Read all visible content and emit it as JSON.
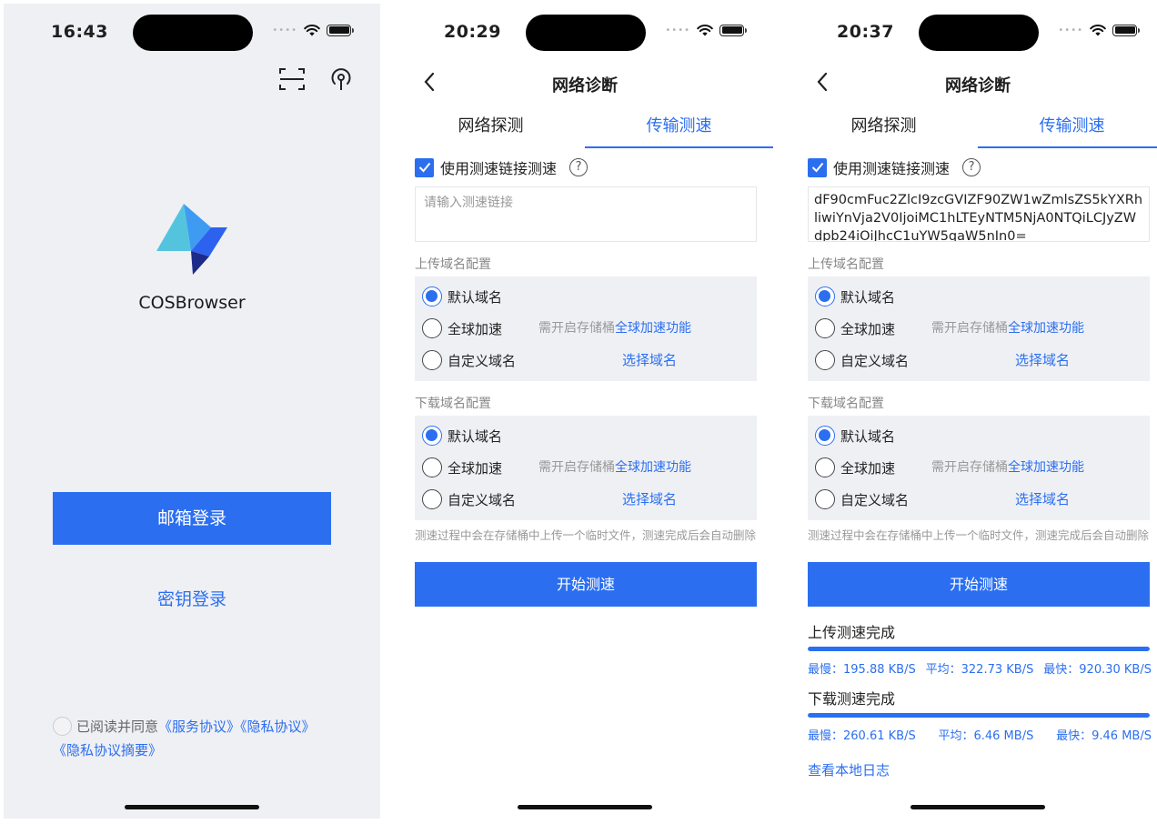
{
  "screen1": {
    "time": "16:43",
    "app_name": "COSBrowser",
    "email_login": "邮箱登录",
    "key_login": "密钥登录",
    "agree_prefix": "已阅读并同意",
    "service_link": "《服务协议》",
    "privacy_link": "《隐私协议》",
    "privacy_summary_link": "《隐私协议摘要》"
  },
  "screen2": {
    "time": "20:29",
    "title": "网络诊断",
    "tabs": [
      "网络探测",
      "传输测速"
    ],
    "checkbox_label": "使用测速链接测速",
    "link_placeholder": "请输入测速链接",
    "upload_label": "上传域名配置",
    "download_label": "下载域名配置",
    "options": {
      "default": "默认域名",
      "global": "全球加速",
      "custom": "自定义域名",
      "note_prefix": "需开启存储桶",
      "note_link": "全球加速功能",
      "choose": "选择域名"
    },
    "hint": "测速过程中会在存储桶中上传一个临时文件，测速完成后会自动删除",
    "start": "开始测速"
  },
  "screen3": {
    "time": "20:37",
    "title": "网络诊断",
    "tabs": [
      "网络探测",
      "传输测速"
    ],
    "checkbox_label": "使用测速链接测速",
    "link_value": "dF90cmFuc2ZlcI9zcGVIZF90ZW1wZmlsZS5kYXRhliwiYnVja2V0IjoiMC1hLTEyNTM5NjA0NTQiLCJyZWdpb24iOiJhcC1uYW5qaW5nIn0=",
    "upload_label": "上传域名配置",
    "download_label": "下载域名配置",
    "options": {
      "default": "默认域名",
      "global": "全球加速",
      "custom": "自定义域名",
      "note_prefix": "需开启存储桶",
      "note_link": "全球加速功能",
      "choose": "选择域名"
    },
    "hint": "测速过程中会在存储桶中上传一个临时文件，测速完成后会自动删除",
    "start": "开始测速",
    "upload_result": {
      "title": "上传测速完成",
      "progress_pct": 100,
      "slowest": "最慢：195.88 KB/S",
      "average": "平均：322.73 KB/S",
      "fastest": "最快：920.30 KB/S"
    },
    "download_result": {
      "title": "下载测速完成",
      "progress_pct": 100,
      "slowest": "最慢：260.61 KB/S",
      "average": "平均：6.46 MB/S",
      "fastest": "最快：9.46 MB/S"
    },
    "view_log": "查看本地日志"
  },
  "colors": {
    "accent": "#2b6ff0",
    "panel_bg": "#eff0f4",
    "muted_text": "#999999"
  }
}
